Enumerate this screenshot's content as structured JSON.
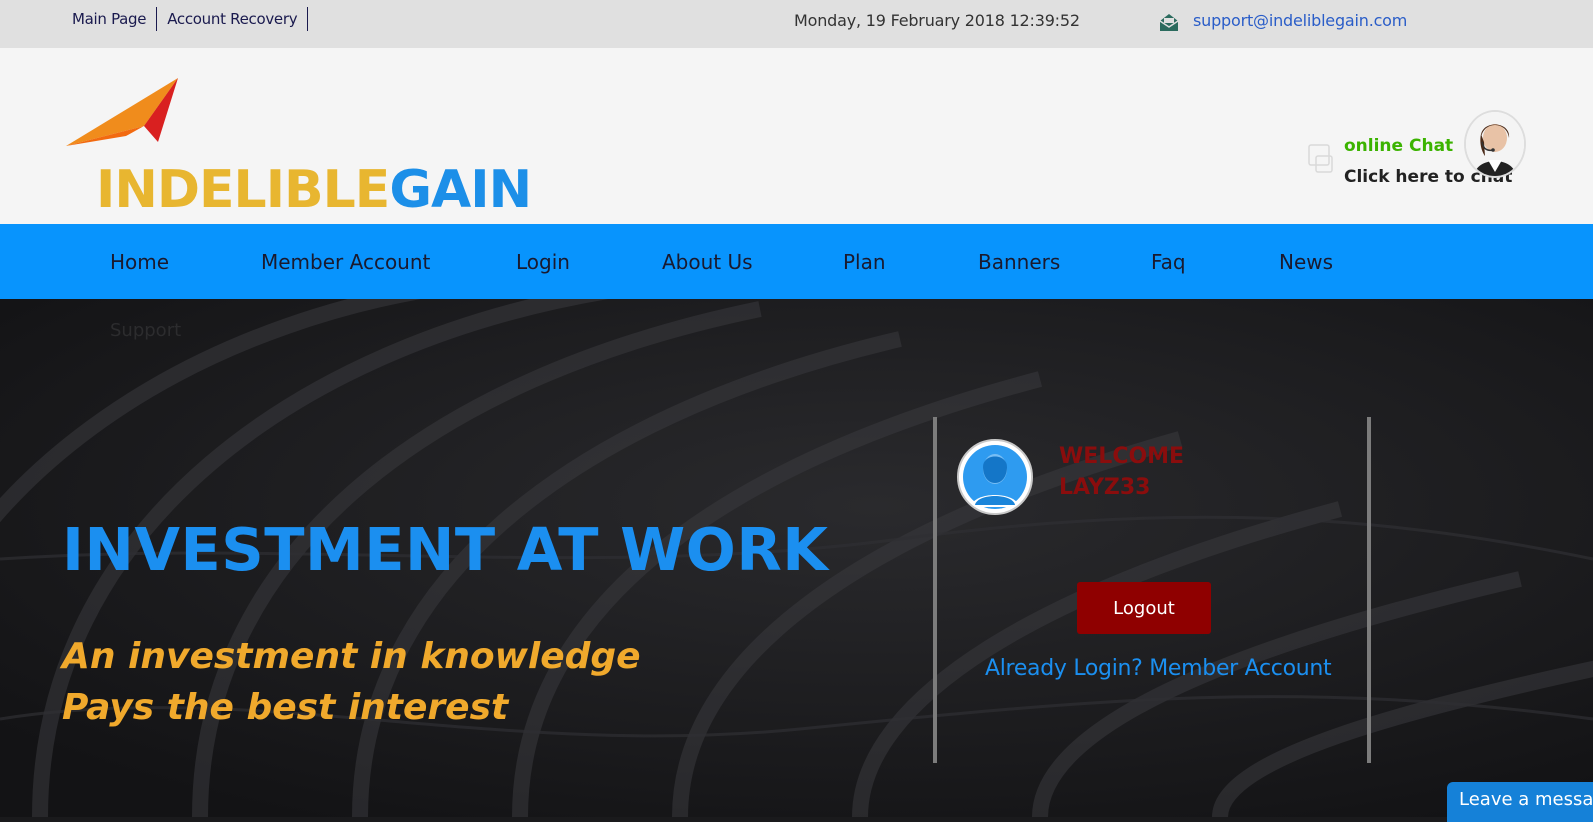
{
  "topbar": {
    "links": [
      "Main Page",
      "Account Recovery"
    ],
    "datetime": "Monday, 19 February 2018 12:39:52",
    "email": "support@indeliblegain.com"
  },
  "logo": {
    "part1": "INDELIBLE",
    "part2": "GAIN"
  },
  "chat": {
    "status": "online Chat",
    "cta": "Click here to chat"
  },
  "nav": {
    "items": [
      "Home",
      "Member Account",
      "Login",
      "About Us",
      "Plan",
      "Banners",
      "Faq",
      "News"
    ],
    "support": "Support"
  },
  "hero": {
    "title": "INVESTMENT AT WORK",
    "subtitle_line1": "An investment in knowledge",
    "subtitle_line2": "Pays the best interest"
  },
  "panel": {
    "welcome": "WELCOME",
    "username": "LAYZ33",
    "logout": "Logout",
    "already_login": "Already Login? Member Account"
  },
  "leave_message": "Leave a message",
  "colors": {
    "nav_bg": "#0894fd",
    "accent_blue": "#1b8ff0",
    "accent_orange": "#f0a92c",
    "logout_bg": "#8f0000",
    "welcome_red": "#8a0d0d"
  }
}
